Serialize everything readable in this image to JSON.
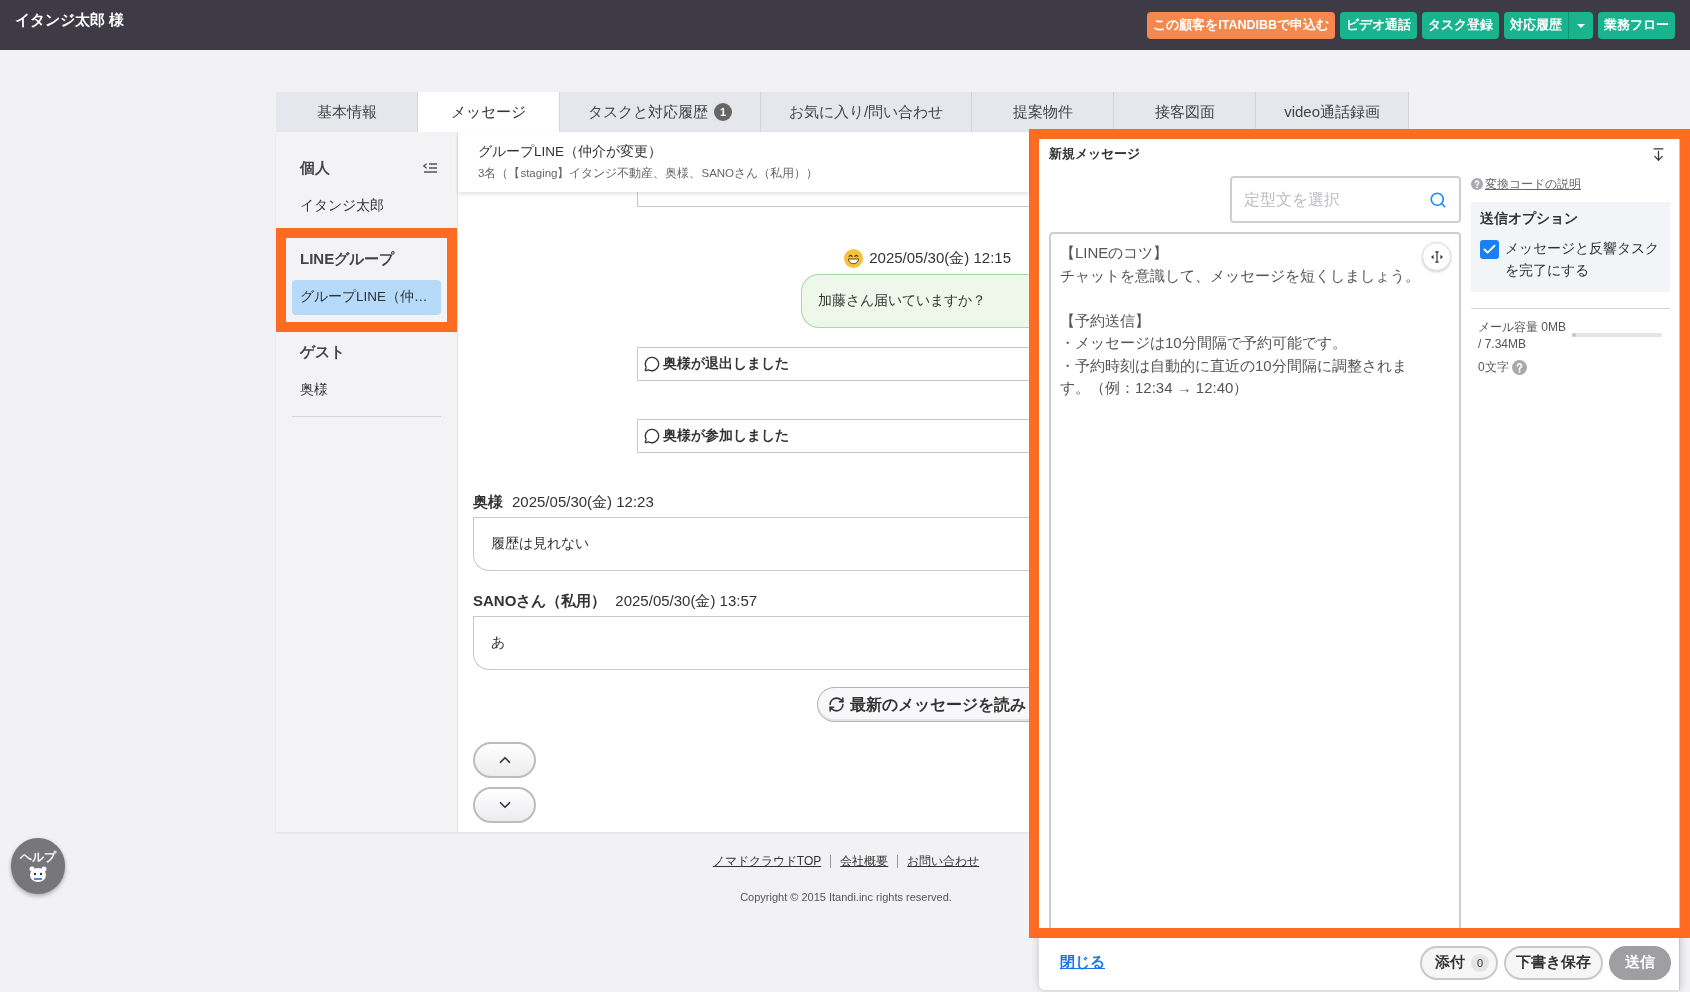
{
  "header": {
    "title": "イタンジ太郎 様",
    "actions": [
      {
        "label": "この顧客をITANDIBBで申込む",
        "kind": "primary"
      },
      {
        "label": "ビデオ通話",
        "kind": "normal"
      },
      {
        "label": "タスク登録",
        "kind": "normal"
      },
      {
        "label": "対応履歴",
        "kind": "split"
      },
      {
        "label": "業務フロー",
        "kind": "normal"
      }
    ]
  },
  "tabs": [
    {
      "label": "基本情報",
      "selected": false
    },
    {
      "label": "メッセージ",
      "selected": true
    },
    {
      "label": "タスクと対応履歴",
      "badge": "1",
      "selected": false
    },
    {
      "label": "お気に入り/問い合わせ",
      "selected": false
    },
    {
      "label": "提案物件",
      "selected": false
    },
    {
      "label": "接客図面",
      "selected": false
    },
    {
      "label": "video通話録画",
      "selected": false
    }
  ],
  "sidebar": {
    "sections": [
      {
        "title": "個人",
        "highlighted": false,
        "items": [
          {
            "label": "イタンジ太郎",
            "selected": false
          }
        ]
      },
      {
        "title": "LINEグループ",
        "highlighted": true,
        "items": [
          {
            "label": "グループLINE（仲…",
            "selected": true
          }
        ]
      },
      {
        "title": "ゲスト",
        "highlighted": false,
        "items": [
          {
            "label": "奥様",
            "selected": false
          }
        ]
      }
    ]
  },
  "chat": {
    "title": "グループLINE（仲介が変更）",
    "members": "3名（【staging】イタンジ不動産、奥様、SANOさん（私用））",
    "messages": [
      {
        "kind": "clipped"
      },
      {
        "kind": "outgoing",
        "time": "2025/05/30(金) 12:15",
        "text": "加藤さん届いていますか？"
      },
      {
        "kind": "system",
        "text": "奥様が退出しました"
      },
      {
        "kind": "system",
        "text": "奥様が参加しました"
      },
      {
        "kind": "incoming",
        "sender": "奥様",
        "time": "2025/05/30(金) 12:23",
        "text": "履歴は見れない"
      },
      {
        "kind": "incoming",
        "sender": "SANOさん（私用）",
        "time": "2025/05/30(金) 13:57",
        "text": "あ"
      }
    ],
    "reload": "最新のメッセージを読み"
  },
  "footer": {
    "links": [
      "ノマドクラウドTOP",
      "会社概要",
      "お問い合わせ"
    ],
    "copyright": "Copyright © 2015 Itandi.inc rights reserved."
  },
  "help": "ヘルプ",
  "composer": {
    "highlighted": true,
    "title": "新規メッセージ",
    "template": {
      "placeholder": "定型文を選択"
    },
    "code_help": "変換コードの説明",
    "body": [
      [
        "【LINEのコツ】",
        "チャットを意識して、メッセージを短くしましょう。"
      ],
      [
        "【予約送信】",
        "・メッセージは10分間隔で予約可能です。",
        "・予約時刻は自動的に直近の10分間隔に調整されます。（例：12:34 → 12:40）"
      ]
    ],
    "options": {
      "title": "送信オプション",
      "items": [
        {
          "label": "メッセージと反響タスクを完了にする",
          "checked": true
        }
      ]
    },
    "capacity": {
      "text": "メール容量 0MB\n/ 7.34MB",
      "level": 0
    },
    "char_count": "0文字",
    "close": "閉じる",
    "attach": {
      "label": "添付",
      "count": "0"
    },
    "draft": "下書き保存",
    "send": {
      "label": "送信",
      "disabled": true
    }
  }
}
